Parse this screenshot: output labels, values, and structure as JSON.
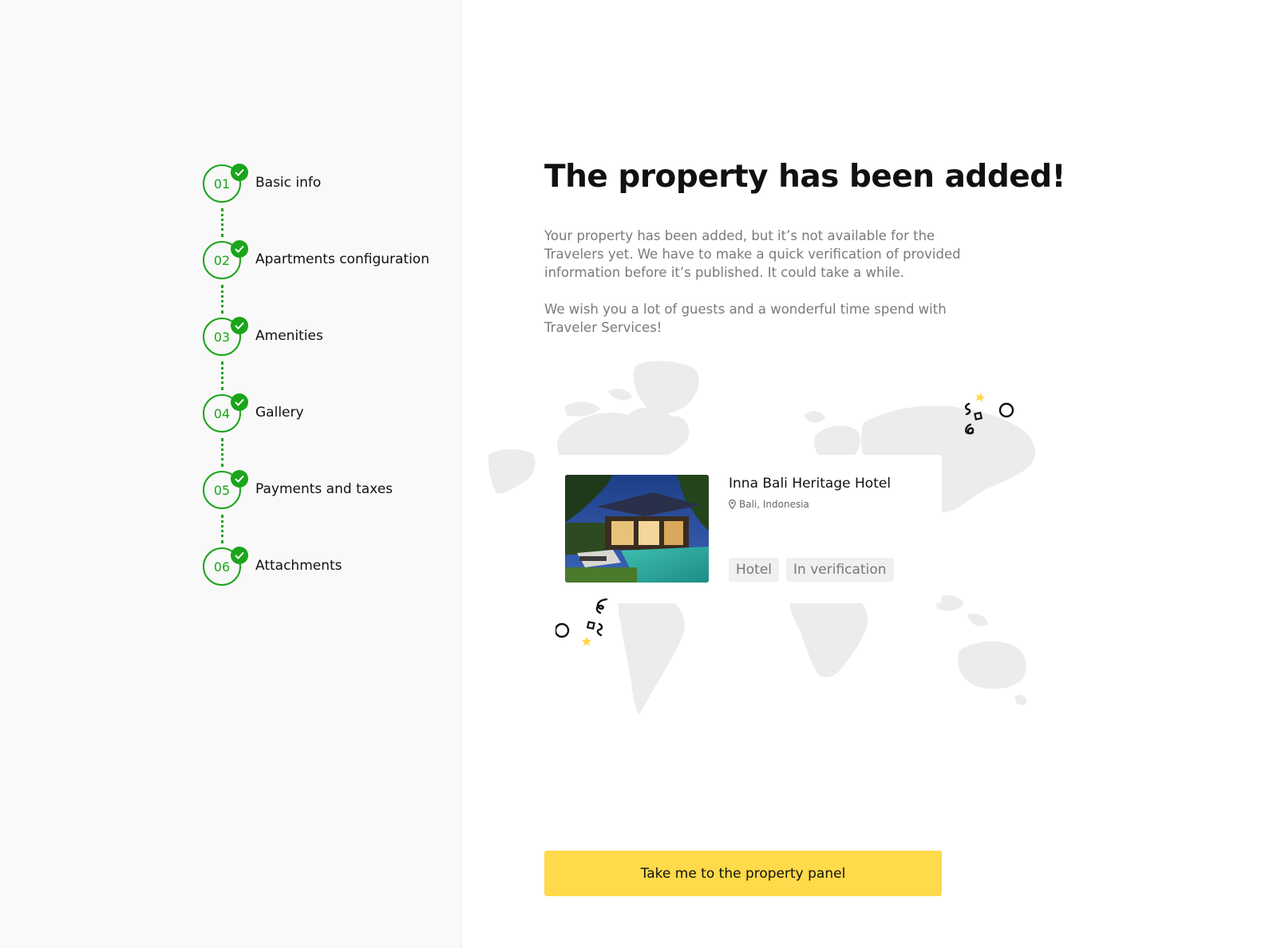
{
  "steps": [
    {
      "number": "01",
      "label": "Basic info",
      "completed": true
    },
    {
      "number": "02",
      "label": "Apartments configuration",
      "completed": true
    },
    {
      "number": "03",
      "label": "Amenities",
      "completed": true
    },
    {
      "number": "04",
      "label": "Gallery",
      "completed": true
    },
    {
      "number": "05",
      "label": "Payments and taxes",
      "completed": true
    },
    {
      "number": "06",
      "label": "Attachments",
      "completed": true
    }
  ],
  "main": {
    "title": "The property has been added!",
    "paragraph1": "Your property has been added, but it’s not available for the Travelers yet. We have to make a quick verification of provided information before it’s published. It could take a while.",
    "paragraph2": "We wish you a lot of guests and a wonderful time spend with Traveler Services!"
  },
  "property": {
    "name": "Inna Bali Heritage Hotel",
    "location": "Bali, Indonesia",
    "tags": [
      "Hotel",
      "In verification"
    ]
  },
  "cta": {
    "label": "Take me to the property panel"
  },
  "colors": {
    "accent_green": "#1aa51a",
    "cta_yellow": "#ffda4a",
    "confetti_yellow": "#ffd84d"
  }
}
